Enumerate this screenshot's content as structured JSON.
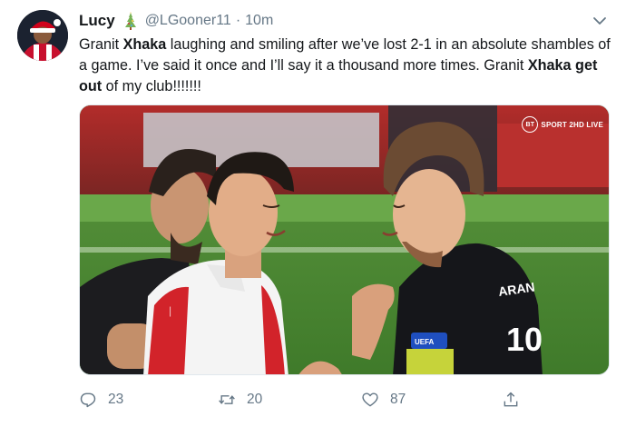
{
  "user": {
    "name": "Lucy",
    "handle": "@LGooner11",
    "separator": "·",
    "time": "10m"
  },
  "tweet": {
    "segments": [
      {
        "text": "Granit ",
        "bold": false
      },
      {
        "text": "Xhaka",
        "bold": true
      },
      {
        "text": " laughing and smiling after we’ve lost 2-1 in an absolute shambles of a game. I’ve said it once and I’ll say it a thousand more times. Granit ",
        "bold": false
      },
      {
        "text": "Xhaka get out",
        "bold": true
      },
      {
        "text": " of my club!!!!!!!",
        "bold": false
      }
    ]
  },
  "media": {
    "broadcaster_logo": "BT",
    "broadcaster_label": "SPORT 2HD LIVE",
    "shirt_name": "ARAN",
    "shirt_number": "10",
    "sleeve_badge": "UEFA"
  },
  "actions": {
    "replies": "23",
    "retweets": "20",
    "likes": "87"
  },
  "icons": {
    "reply": "reply-icon",
    "retweet": "retweet-icon",
    "like": "heart-icon",
    "share": "share-icon",
    "caret": "chevron-down-icon",
    "badge": "christmas-tree-badge-icon"
  },
  "colors": {
    "text": "#14171a",
    "secondary": "#657786",
    "pitch": "#5b8f3e",
    "arsenal_red": "#d2232a"
  }
}
